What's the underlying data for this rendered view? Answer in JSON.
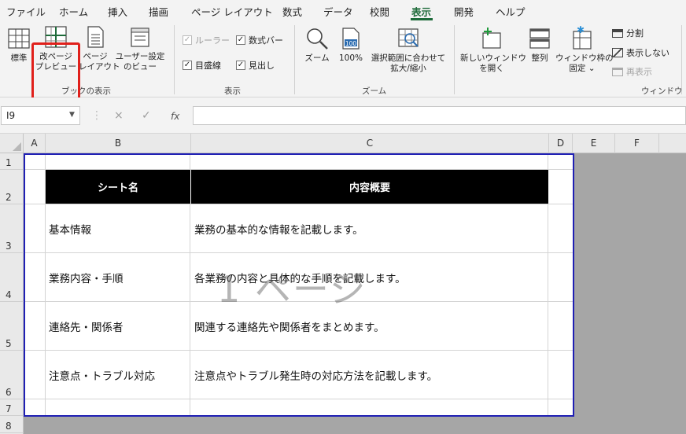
{
  "menu": {
    "tabs": [
      "ファイル",
      "ホーム",
      "挿入",
      "描画",
      "ページ レイアウト",
      "数式",
      "データ",
      "校閲",
      "表示",
      "開発",
      "ヘルプ"
    ],
    "active_tab": "表示"
  },
  "ribbon": {
    "book_views": {
      "group_label": "ブックの表示",
      "normal": "標準",
      "page_break_line1": "改ページ",
      "page_break_line2": "プレビュー",
      "page_layout_line1": "ページ",
      "page_layout_line2": "レイアウト",
      "custom_line1": "ユーザー設定",
      "custom_line2": "のビュー"
    },
    "show": {
      "group_label": "表示",
      "ruler": "ルーラー",
      "formula_bar": "数式バー",
      "gridlines": "目盛線",
      "headings": "見出し"
    },
    "zoom": {
      "group_label": "ズーム",
      "zoom": "ズーム",
      "hundred": "100%",
      "hundred_icon": "100",
      "fit_line1": "選択範囲に合わせて",
      "fit_line2": "拡大/縮小"
    },
    "window": {
      "group_label": "ウィンドウ",
      "new_window_line1": "新しいウィンドウ",
      "new_window_line2": "を開く",
      "arrange": "整列",
      "freeze_line1": "ウィンドウ枠の",
      "freeze_line2": "固定",
      "split": "分割",
      "hide": "表示しない",
      "unhide": "再表示"
    }
  },
  "formula_bar": {
    "name_box": "I9",
    "cancel_icon": "×",
    "enter_icon": "✓",
    "fx_label": "fx",
    "formula": ""
  },
  "sheet": {
    "columns": [
      "A",
      "B",
      "C",
      "D",
      "E",
      "F"
    ],
    "rows": [
      "1",
      "2",
      "3",
      "4",
      "5",
      "6",
      "7",
      "8"
    ],
    "table": {
      "headers": [
        "シート名",
        "内容概要"
      ],
      "rows": [
        [
          "基本情報",
          "業務の基本的な情報を記載します。"
        ],
        [
          "業務内容・手順",
          "各業務の内容と具体的な手順を記載します。"
        ],
        [
          "連絡先・関係者",
          "関連する連絡先や関係者をまとめます。"
        ],
        [
          "注意点・トラブル対応",
          "注意点やトラブル発生時の対応方法を記載します。"
        ]
      ]
    },
    "page_watermark": "1 ページ"
  },
  "colors": {
    "accent": "#1e6b3a",
    "highlight": "#e0201b",
    "print_area_border": "#1f1fb4",
    "table_header_bg": "#000000",
    "outside_print_area": "#a6a6a6"
  }
}
